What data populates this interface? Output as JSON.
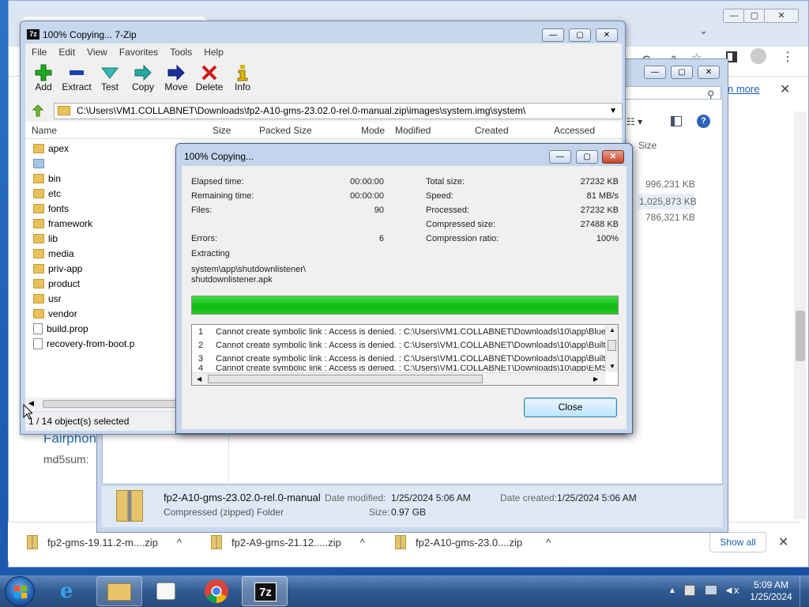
{
  "chrome": {
    "learn_more": "n more",
    "left_heading": "Fairphon",
    "md5_label": "md5sum:",
    "downloads": [
      {
        "name": "fp2-gms-19.11.2-m....zip"
      },
      {
        "name": "fp2-A9-gms-21.12.....zip"
      },
      {
        "name": "fp2-A10-gms-23.0....zip"
      }
    ],
    "show_all": "Show all",
    "caret_up": "^",
    "close_x": "✕"
  },
  "explorer": {
    "size_header": "Size",
    "sizes": [
      "996,231 KB",
      "1,025,873 KB",
      "786,321 KB"
    ],
    "details": {
      "name": "fp2-A10-gms-23.02.0-rel.0-manual",
      "type": "Compressed (zipped) Folder",
      "modified_label": "Date modified:",
      "modified_value": "1/25/2024 5:06 AM",
      "created_label": "Date created:",
      "created_value": "1/25/2024 5:06 AM",
      "size_label": "Size:",
      "size_value": "0.97 GB"
    }
  },
  "zip": {
    "title": "100% Copying... 7-Zip",
    "menu": [
      "File",
      "Edit",
      "View",
      "Favorites",
      "Tools",
      "Help"
    ],
    "toolbar": [
      "Add",
      "Extract",
      "Test",
      "Copy",
      "Move",
      "Delete",
      "Info"
    ],
    "path": "C:\\Users\\VM1.COLLABNET\\Downloads\\fp2-A10-gms-23.02.0-rel.0-manual.zip\\images\\system.img\\system\\",
    "columns": [
      "Name",
      "Size",
      "Packed Size",
      "Mode",
      "Modified",
      "Created",
      "Accessed"
    ],
    "items": [
      {
        "name": "apex",
        "type": "folder"
      },
      {
        "name": "",
        "type": "folder-blue"
      },
      {
        "name": "bin",
        "type": "folder"
      },
      {
        "name": "etc",
        "type": "folder"
      },
      {
        "name": "fonts",
        "type": "folder"
      },
      {
        "name": "framework",
        "type": "folder"
      },
      {
        "name": "lib",
        "type": "folder"
      },
      {
        "name": "media",
        "type": "folder"
      },
      {
        "name": "priv-app",
        "type": "folder"
      },
      {
        "name": "product",
        "type": "folder"
      },
      {
        "name": "usr",
        "type": "folder"
      },
      {
        "name": "vendor",
        "type": "folder"
      },
      {
        "name": "build.prop",
        "type": "file"
      },
      {
        "name": "recovery-from-boot.p",
        "type": "file"
      }
    ],
    "status": "1 / 14 object(s) selected"
  },
  "dialog": {
    "title": "100% Copying...",
    "elapsed_label": "Elapsed time:",
    "elapsed_value": "00:00:00",
    "remaining_label": "Remaining time:",
    "remaining_value": "00:00:00",
    "files_label": "Files:",
    "files_value": "90",
    "errors_label": "Errors:",
    "errors_value": "6",
    "total_label": "Total size:",
    "total_value": "27232 KB",
    "speed_label": "Speed:",
    "speed_value": "81 MB/s",
    "processed_label": "Processed:",
    "processed_value": "27232 KB",
    "compressed_label": "Compressed size:",
    "compressed_value": "27488 KB",
    "ratio_label": "Compression ratio:",
    "ratio_value": "100%",
    "action": "Extracting",
    "current_file_line1": "system\\app\\shutdownlistener\\",
    "current_file_line2": "shutdownlistener.apk",
    "progress": 1.0,
    "errors": [
      {
        "n": "1",
        "text": "Cannot create symbolic link : Access is denied. : C:\\Users\\VM1.COLLABNET\\Downloads\\10\\app\\Blue"
      },
      {
        "n": "2",
        "text": "Cannot create symbolic link : Access is denied. : C:\\Users\\VM1.COLLABNET\\Downloads\\10\\app\\Built"
      },
      {
        "n": "3",
        "text": "Cannot create symbolic link : Access is denied. : C:\\Users\\VM1.COLLABNET\\Downloads\\10\\app\\Built"
      },
      {
        "n": "4",
        "text": "Cannot create symbolic link : Access is denied. : C:\\Users\\VM1.COLLABNET\\Downloads\\10\\app\\EMS"
      }
    ],
    "close_label": "Close"
  },
  "taskbar": {
    "time": "5:09 AM",
    "date": "1/25/2024",
    "zip_label": "7z"
  }
}
